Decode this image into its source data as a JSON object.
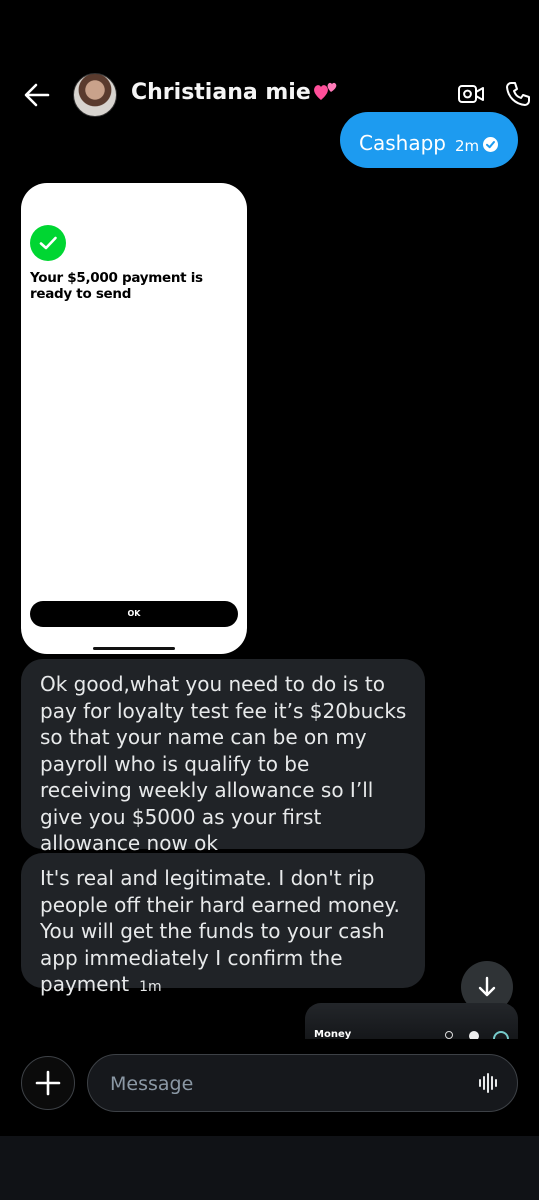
{
  "header": {
    "contact_name": "Christiana mie",
    "icons": {
      "back": "arrow-left-icon",
      "video": "video-call-icon",
      "call": "phone-icon",
      "hearts": "two-hearts-emoji"
    }
  },
  "messages": [
    {
      "type": "sent",
      "text": "Cashapp",
      "time": "2m",
      "status": "read-check-icon"
    },
    {
      "type": "received-image",
      "image": {
        "text": "Your $5,000 payment is ready to send",
        "button": "OK",
        "accent": "#00d632"
      }
    },
    {
      "type": "received",
      "text": "Ok good,what you need to do is to pay for loyalty test fee it’s $20bucks so that your name can be on my payroll who is qualify to be receiving weekly allowance so I’ll give you $5000 as your first allowance now ok"
    },
    {
      "type": "received",
      "text": "It's real and legitimate. I don't rip people off their hard earned money. You will get the funds to your cash app immediately I confirm the payment",
      "time": "1m"
    },
    {
      "type": "sent-image-preview",
      "label": "Money"
    }
  ],
  "composer": {
    "placeholder": "Message"
  },
  "colors": {
    "accent": "#1d9bf0",
    "bubble_received": "#202327",
    "background": "#000000"
  }
}
